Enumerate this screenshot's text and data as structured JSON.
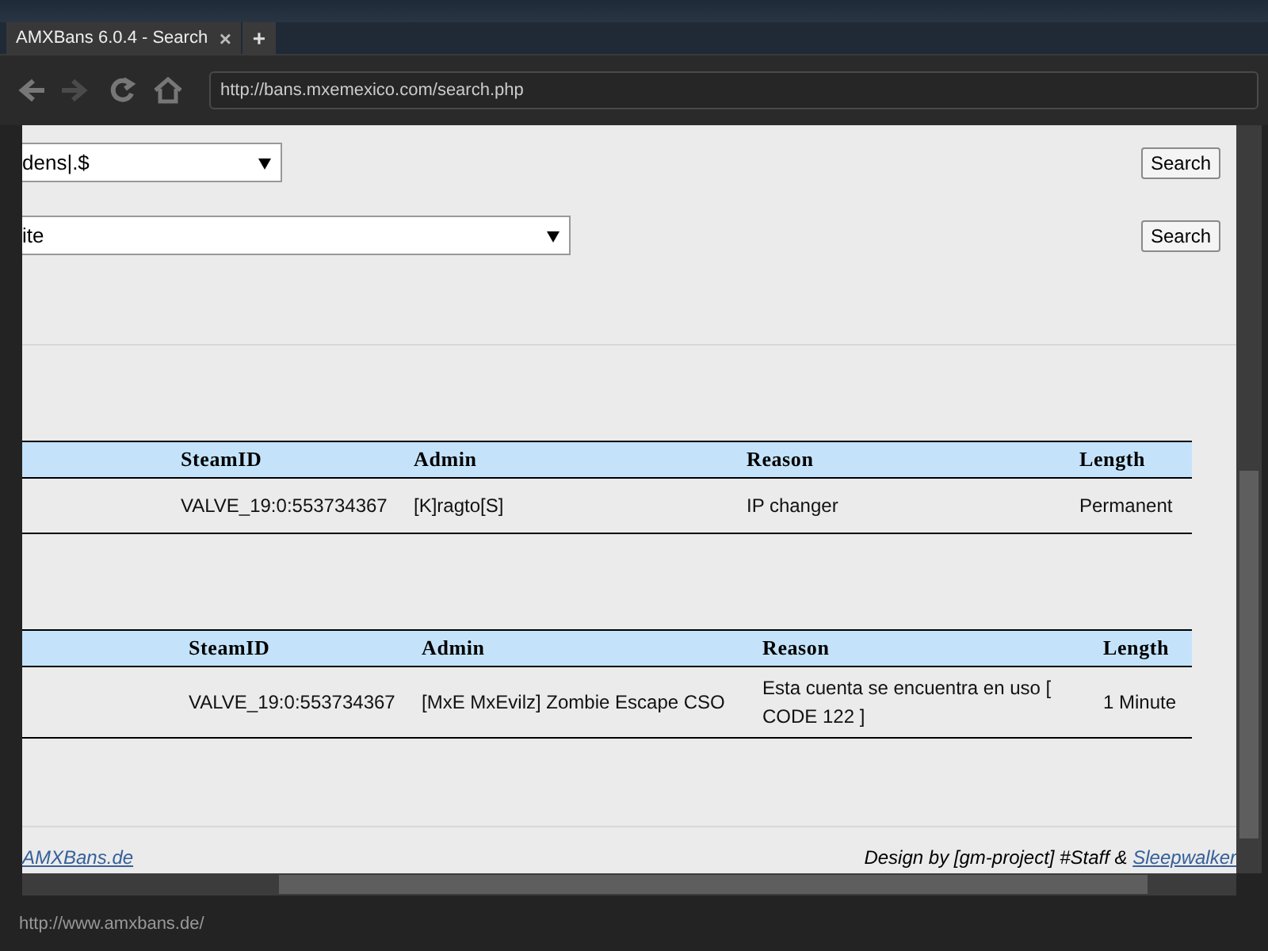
{
  "tab": {
    "title": "AMXBans 6.0.4 - Search",
    "close": "×",
    "new_tab": "+"
  },
  "nav_buttons": [
    {
      "kind": "back",
      "disabled": false
    },
    {
      "kind": "forward",
      "disabled": true
    },
    {
      "kind": "reload",
      "disabled": false
    },
    {
      "kind": "home",
      "disabled": false
    }
  ],
  "address_bar": {
    "url": "http://bans.mxemexico.com/search.php"
  },
  "search_rows": [
    {
      "value": "dens|.$",
      "wide": false,
      "button": "Search"
    },
    {
      "value": "ite",
      "wide": true,
      "button": "Search"
    }
  ],
  "tables": [
    {
      "columns": [
        "SteamID",
        "Admin",
        "Reason",
        "Length"
      ],
      "rows": [
        [
          "VALVE_19:0:553734367",
          "[K]ragto[S]",
          "IP changer",
          "Permanent"
        ]
      ]
    },
    {
      "columns": [
        "SteamID",
        "Admin",
        "Reason",
        "Length"
      ],
      "rows": [
        [
          "VALVE_19:0:553734367",
          "[MxE MxEvilz] Zombie Escape CSO",
          "Esta cuenta se encuentra en uso [ CODE 122 ]",
          "1 Minute"
        ]
      ]
    }
  ],
  "footer": {
    "link": "AMXBans.de",
    "credit": "Design by [gm-project] #Staff &",
    "credit_link": "Sleepwalker"
  },
  "status_bar": {
    "url": "http://www.amxbans.de/"
  }
}
